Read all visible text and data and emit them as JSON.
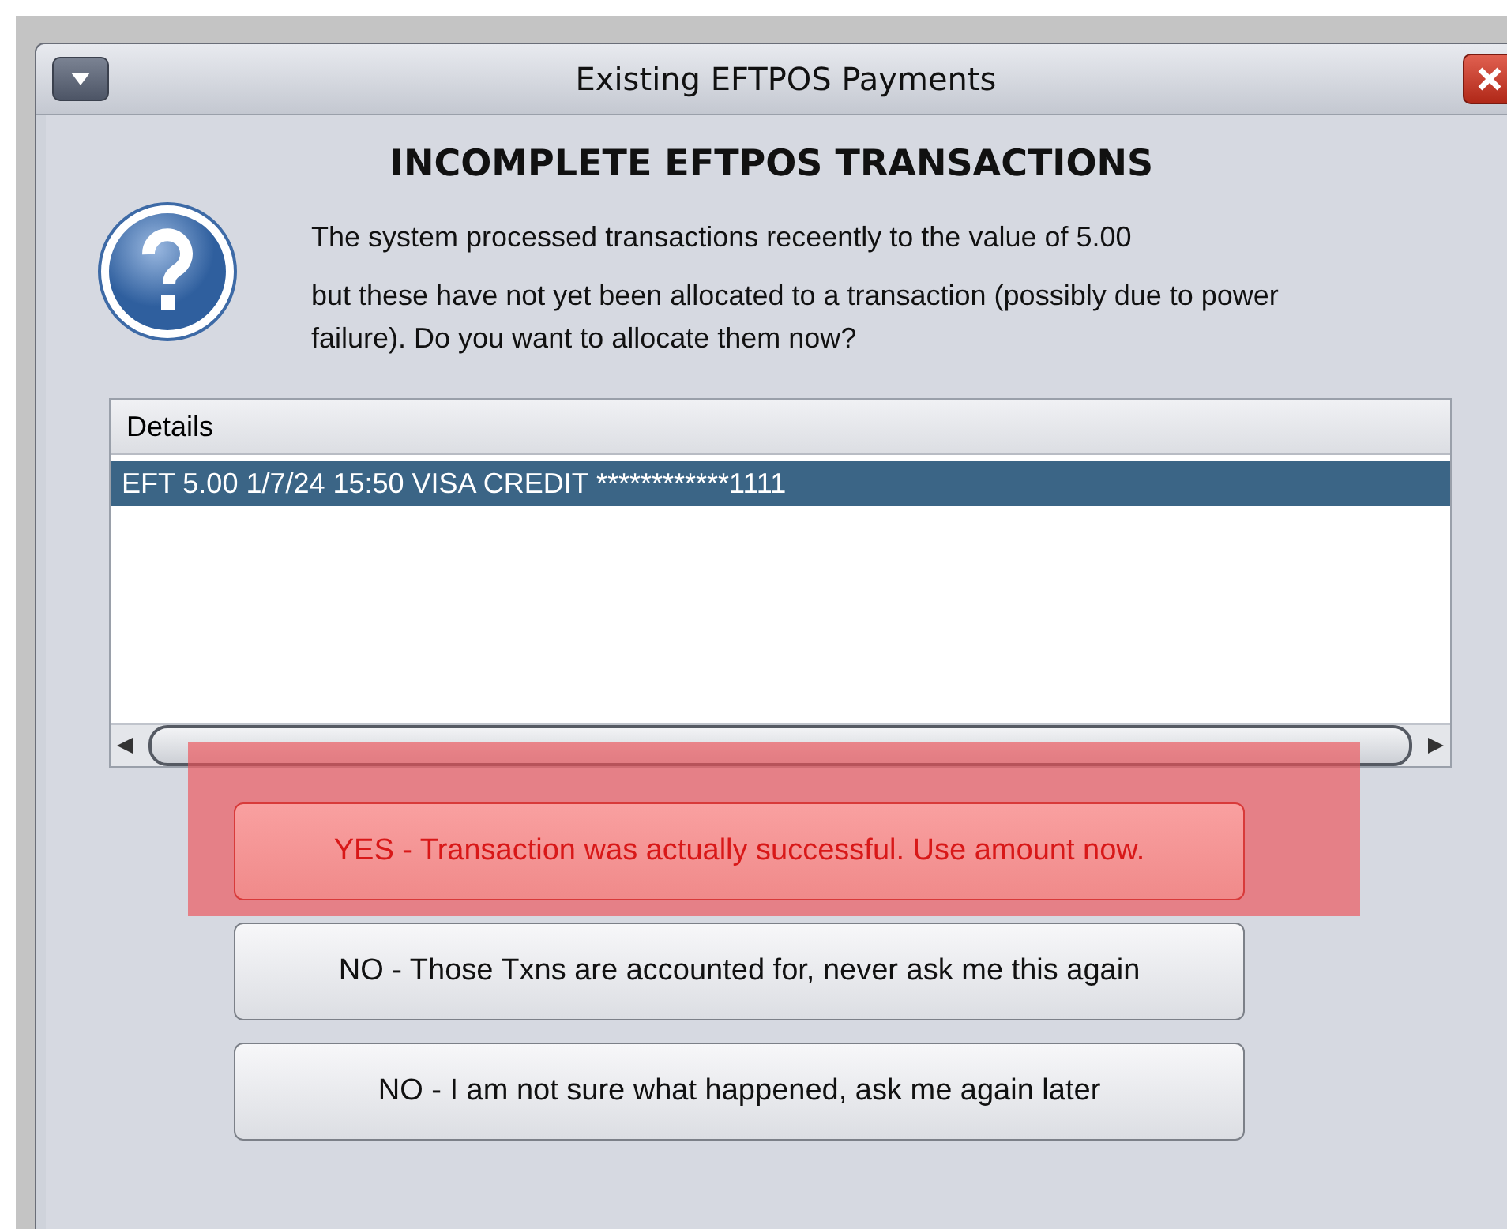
{
  "window": {
    "title": "Existing EFTPOS Payments"
  },
  "heading": "INCOMPLETE EFTPOS TRANSACTIONS",
  "message": {
    "line_1": "The system processed transactions receently to the value of  5.00",
    "line_2": "but these have not yet been allocated to a transaction (possibly due to power failure). Do you want to allocate them now?"
  },
  "table": {
    "columns": [
      "Details"
    ],
    "rows": [
      {
        "cells": [
          "EFT 5.00 1/7/24 15:50 VISA CREDIT ************1111"
        ],
        "selected": true
      }
    ]
  },
  "buttons": [
    {
      "label": "YES - Transaction was actually successful. Use amount now.",
      "highlighted": true
    },
    {
      "label": "NO - Those Txns are accounted for, never ask me this again",
      "highlighted": false
    },
    {
      "label": "NO - I am not sure what happened, ask me again later",
      "highlighted": false
    }
  ]
}
